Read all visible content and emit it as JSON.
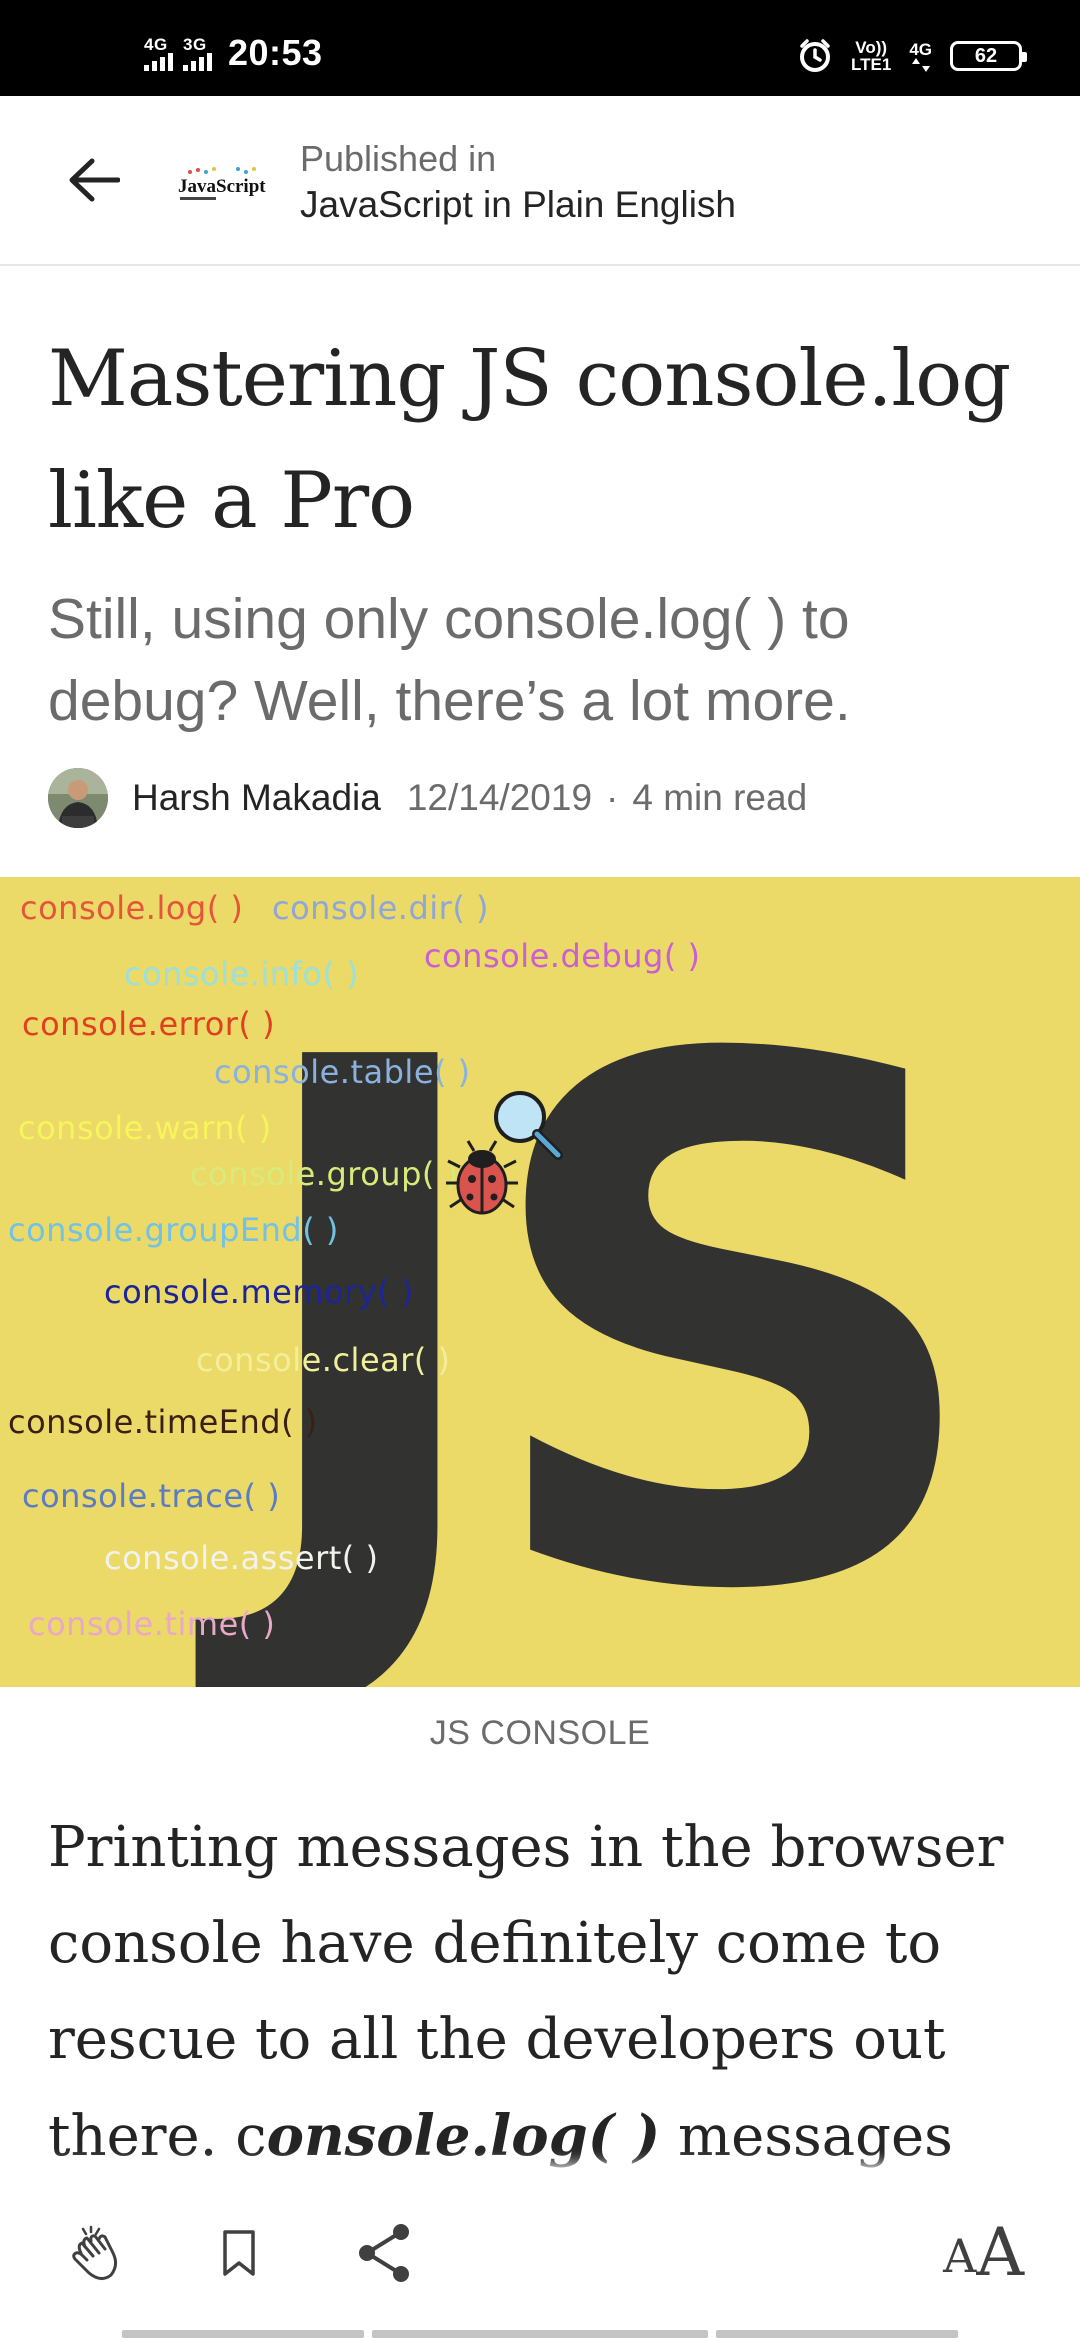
{
  "status_bar": {
    "sim1_label": "4G",
    "sim2_label": "3G",
    "time": "20:53",
    "volte_label": "Vo))",
    "lte_label": "LTE1",
    "net_label": "4G",
    "battery": "62"
  },
  "header": {
    "published_label": "Published in",
    "publication_name": "JavaScript in Plain English",
    "logo_text": "JavaScript"
  },
  "article": {
    "title": "Mastering JS console.log like a Pro",
    "subtitle": "Still, using only console.log( ) to debug? Well, there’s a lot more.",
    "author": "Harsh Makadia",
    "date": "12/14/2019",
    "separator": "·",
    "read_time": "4 min read",
    "caption": "JS CONSOLE",
    "body_before": "Printing messages in the browser console have definitely come to rescue to all the developers out there. c",
    "body_em": "onsole.log( )",
    "body_after": " messages are"
  },
  "hero": {
    "big_text": "JS",
    "functions": [
      {
        "text": "console.log( )",
        "color": "#e4553a"
      },
      {
        "text": "console.dir( )",
        "color": "#8fa6d8"
      },
      {
        "text": "console.debug( )",
        "color": "#c95fd3"
      },
      {
        "text": "console.info( )",
        "color": "#9be0da"
      },
      {
        "text": "console.error( )",
        "color": "#e0401f"
      },
      {
        "text": "console.table( )",
        "color": "#8ab2de"
      },
      {
        "text": "console.warn( )",
        "color": "#f7f45c"
      },
      {
        "text": "console.group( )",
        "color": "#d8ea7a"
      },
      {
        "text": "console.groupEnd( )",
        "color": "#72c2e6"
      },
      {
        "text": "console.memory( )",
        "color": "#1c2598"
      },
      {
        "text": "console.clear( )",
        "color": "#f2ef9a"
      },
      {
        "text": "console.timeEnd( )",
        "color": "#3a1f12"
      },
      {
        "text": "console.trace( )",
        "color": "#5a7cc4"
      },
      {
        "text": "console.assert( )",
        "color": "#f2f2ee"
      },
      {
        "text": "console.time( )",
        "color": "#e9a8c6"
      }
    ]
  },
  "toolbar": {
    "font_small": "A",
    "font_big": "A"
  },
  "colors": {
    "hero_bg": "#ebd968",
    "js_letters": "#323330",
    "text_primary": "#242424",
    "text_secondary": "#6b6b6b"
  }
}
